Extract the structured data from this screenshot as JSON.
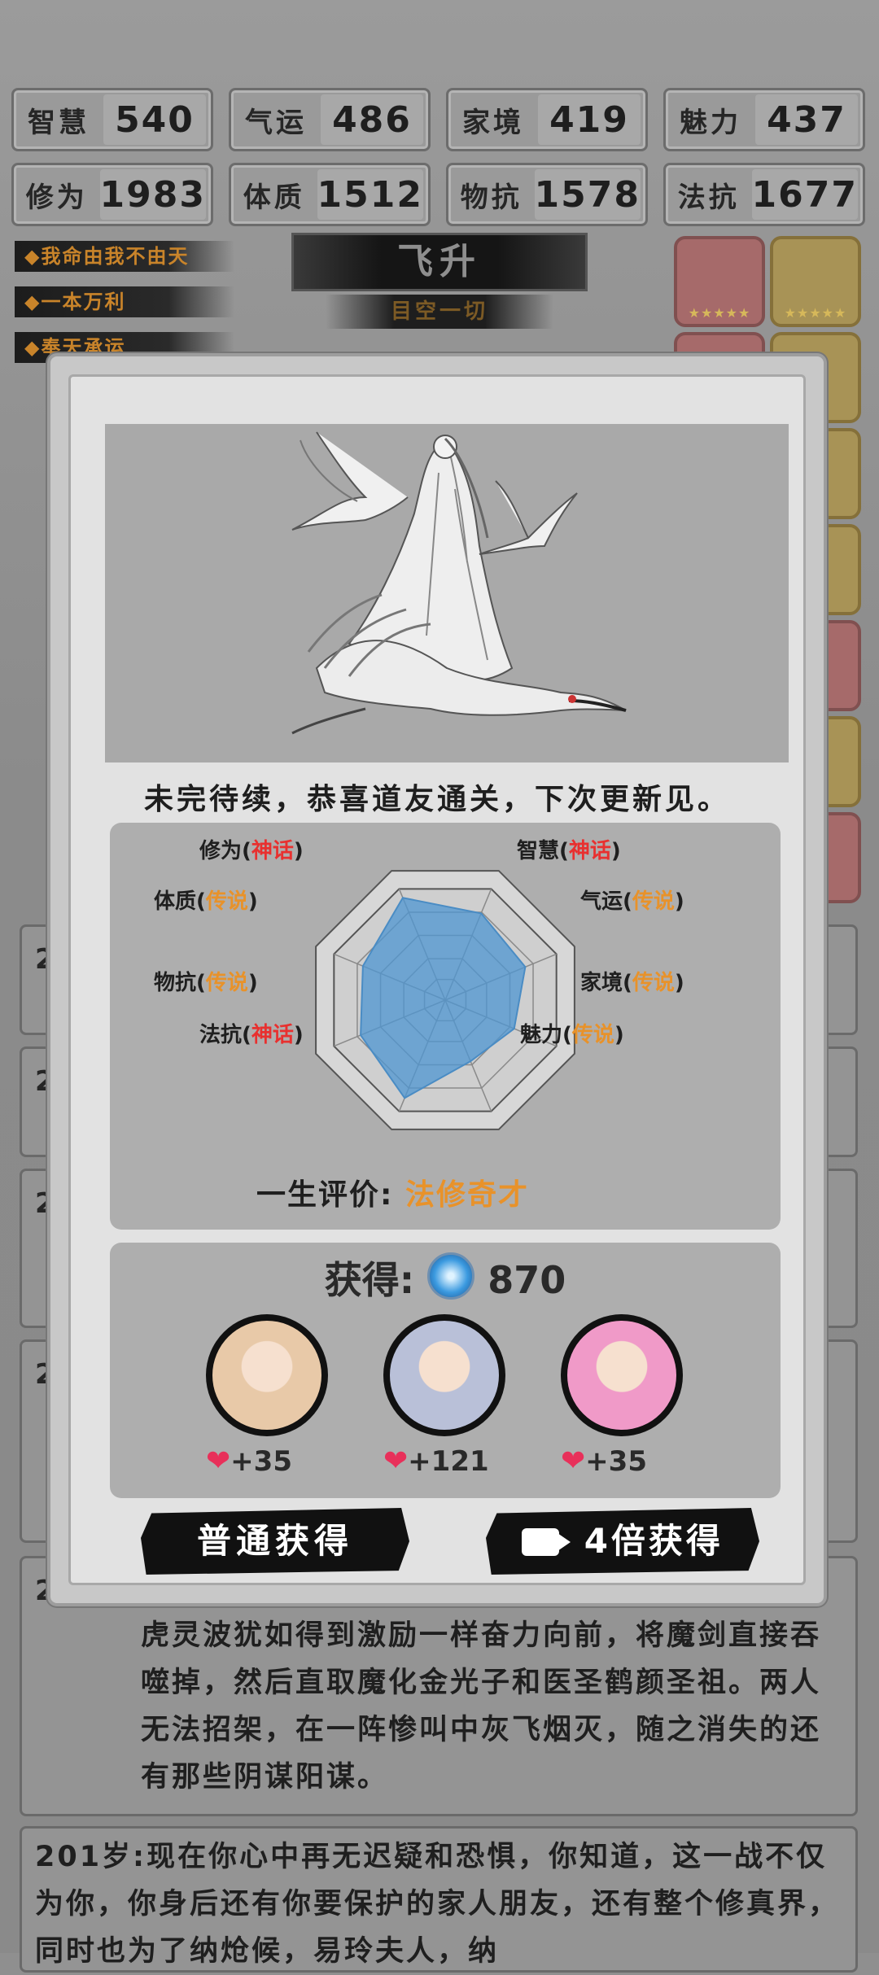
{
  "stats_row1": [
    {
      "label": "智慧",
      "value": "540"
    },
    {
      "label": "气运",
      "value": "486"
    },
    {
      "label": "家境",
      "value": "419"
    },
    {
      "label": "魅力",
      "value": "437"
    }
  ],
  "stats_row2": [
    {
      "label": "修为",
      "value": "1983"
    },
    {
      "label": "体质",
      "value": "1512"
    },
    {
      "label": "物抗",
      "value": "1578"
    },
    {
      "label": "法抗",
      "value": "1677"
    }
  ],
  "traits": [
    "我命由我不由天",
    "一本万利",
    "奉天承运"
  ],
  "banner": {
    "title": "飞升",
    "subtitle": "目空一切"
  },
  "modal": {
    "message": "未完待续，恭喜道友通关，下次更新见。",
    "radar": {
      "labels": [
        {
          "name": "修为",
          "grade": "神话",
          "type": "myth"
        },
        {
          "name": "智慧",
          "grade": "神话",
          "type": "myth"
        },
        {
          "name": "气运",
          "grade": "传说",
          "type": "leg"
        },
        {
          "name": "家境",
          "grade": "传说",
          "type": "leg"
        },
        {
          "name": "魅力",
          "grade": "传说",
          "type": "leg"
        },
        {
          "name": "法抗",
          "grade": "神话",
          "type": "myth"
        },
        {
          "name": "物抗",
          "grade": "传说",
          "type": "leg"
        },
        {
          "name": "体质",
          "grade": "传说",
          "type": "leg"
        }
      ],
      "levels": [
        0.92,
        0.78,
        0.72,
        0.62,
        0.55,
        0.88,
        0.76,
        0.74
      ]
    },
    "evaluation": {
      "label": "一生评价:",
      "value": "法修奇才"
    },
    "reward": {
      "label": "获得:",
      "amount": "870",
      "companions": [
        {
          "amount": "+35",
          "color": "#e8c9a8"
        },
        {
          "amount": "+121",
          "color": "#b9c0d8"
        },
        {
          "amount": "+35",
          "color": "#f09ac8"
        }
      ]
    },
    "buttons": {
      "normal": "普通获得",
      "quad": "4倍获得"
    }
  },
  "log": {
    "age_partial": "2",
    "entry1": "虎灵波犹如得到激励一样奋力向前，将魔剑直接吞噬掉，然后直取魔化金光子和医圣鹤颜圣祖。两人无法招架，在一阵惨叫中灰飞烟灭，随之消失的还有那些阴谋阳谋。",
    "entry2_age": "201岁:",
    "entry2": "现在你心中再无迟疑和恐惧，你知道，这一战不仅为你，你身后还有你要保护的家人朋友，还有整个修真界，同时也为了纳炝候，易玲夫人，纳"
  }
}
